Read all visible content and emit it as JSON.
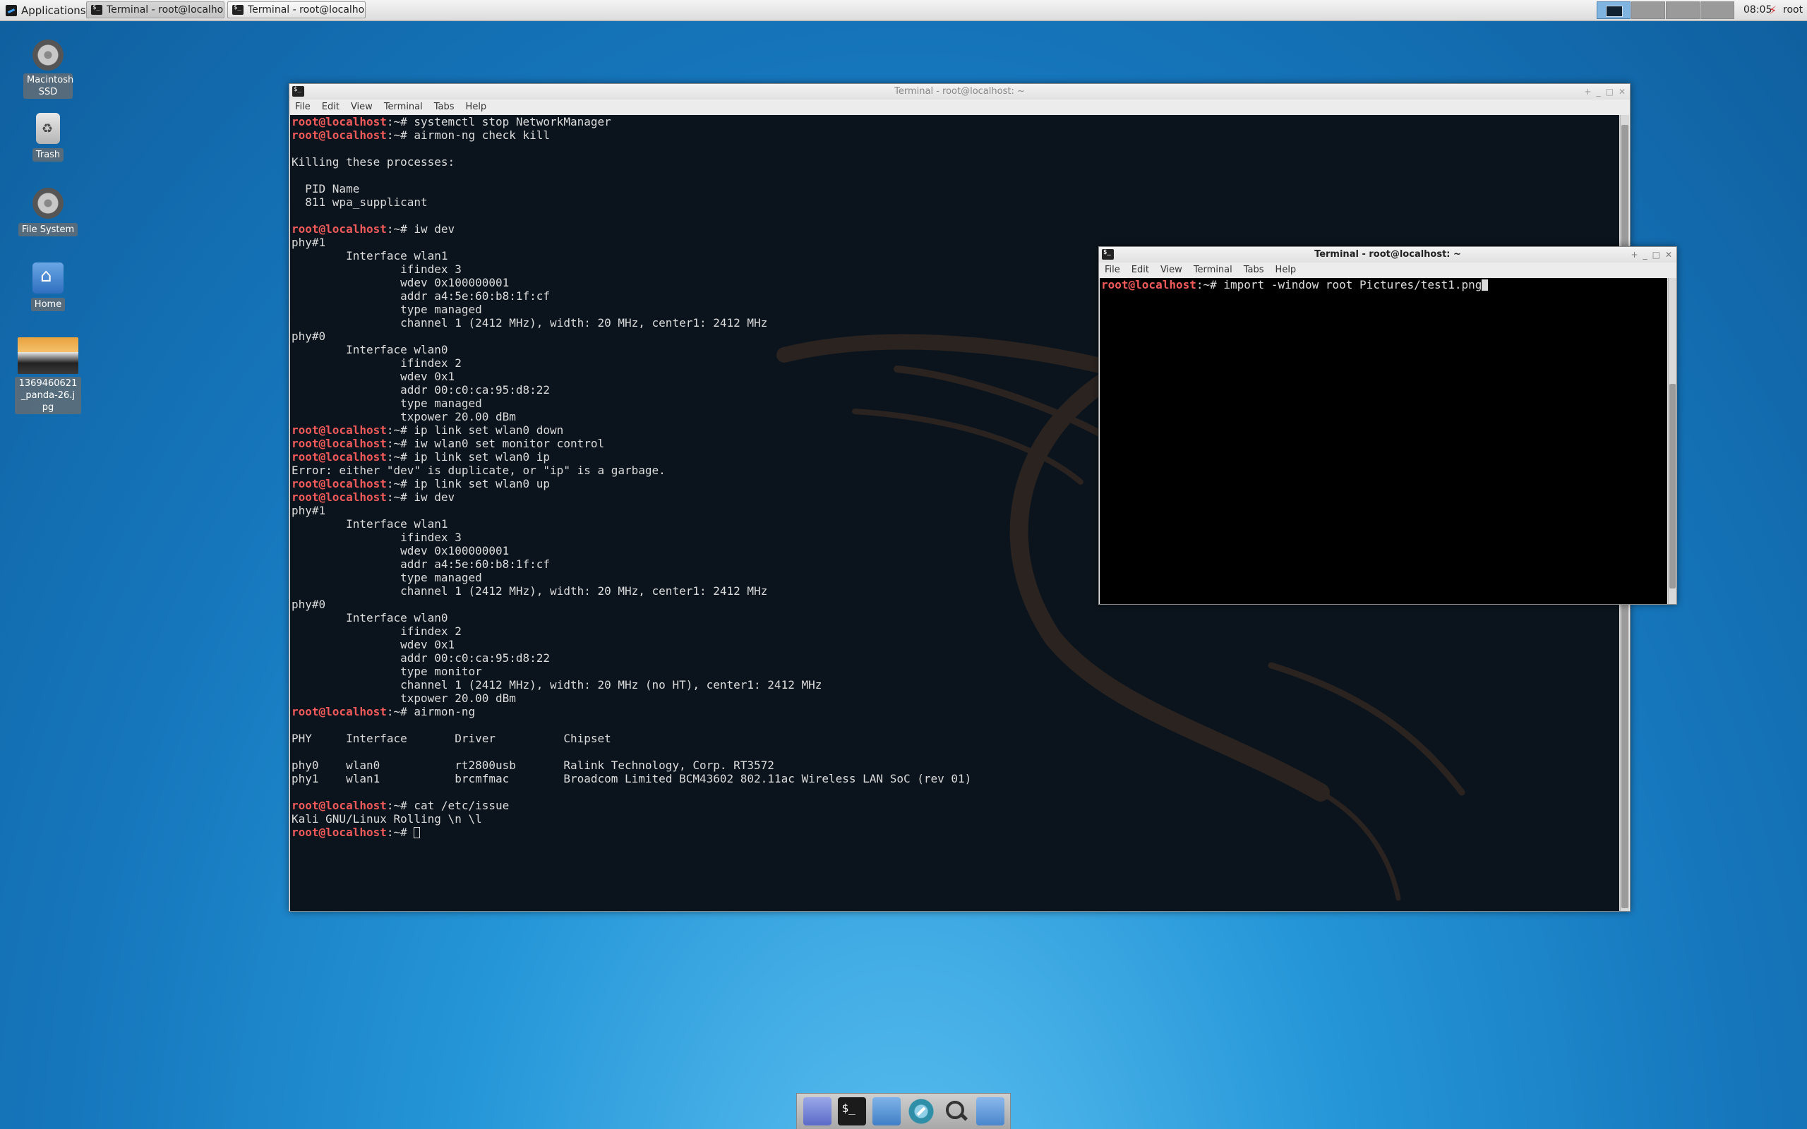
{
  "panel": {
    "applications_label": "Applications",
    "tasks": [
      "Terminal - root@localho...",
      "Terminal - root@localho..."
    ],
    "clock": "08:05",
    "user": "root"
  },
  "desktop": {
    "icons": [
      {
        "name": "macintosh-ssd",
        "label": "Macintosh SSD"
      },
      {
        "name": "trash",
        "label": "Trash"
      },
      {
        "name": "file-system",
        "label": "File System"
      },
      {
        "name": "home",
        "label": "Home"
      },
      {
        "name": "panda-image",
        "label": "1369460621_panda-26.jpg"
      }
    ]
  },
  "main_window": {
    "title": "Terminal - root@localhost: ~",
    "menu": [
      "File",
      "Edit",
      "View",
      "Terminal",
      "Tabs",
      "Help"
    ],
    "lines": [
      {
        "p": "root@localhost",
        "s": ":~# ",
        "t": "systemctl stop NetworkManager"
      },
      {
        "p": "root@localhost",
        "s": ":~# ",
        "t": "airmon-ng check kill"
      },
      {
        "t": ""
      },
      {
        "t": "Killing these processes:"
      },
      {
        "t": ""
      },
      {
        "t": "  PID Name"
      },
      {
        "t": "  811 wpa_supplicant"
      },
      {
        "t": ""
      },
      {
        "p": "root@localhost",
        "s": ":~# ",
        "t": "iw dev"
      },
      {
        "t": "phy#1"
      },
      {
        "t": "        Interface wlan1"
      },
      {
        "t": "                ifindex 3"
      },
      {
        "t": "                wdev 0x100000001"
      },
      {
        "t": "                addr a4:5e:60:b8:1f:cf"
      },
      {
        "t": "                type managed"
      },
      {
        "t": "                channel 1 (2412 MHz), width: 20 MHz, center1: 2412 MHz"
      },
      {
        "t": "phy#0"
      },
      {
        "t": "        Interface wlan0"
      },
      {
        "t": "                ifindex 2"
      },
      {
        "t": "                wdev 0x1"
      },
      {
        "t": "                addr 00:c0:ca:95:d8:22"
      },
      {
        "t": "                type managed"
      },
      {
        "t": "                txpower 20.00 dBm"
      },
      {
        "p": "root@localhost",
        "s": ":~# ",
        "t": "ip link set wlan0 down"
      },
      {
        "p": "root@localhost",
        "s": ":~# ",
        "t": "iw wlan0 set monitor control"
      },
      {
        "p": "root@localhost",
        "s": ":~# ",
        "t": "ip link set wlan0 ip"
      },
      {
        "t": "Error: either \"dev\" is duplicate, or \"ip\" is a garbage."
      },
      {
        "p": "root@localhost",
        "s": ":~# ",
        "t": "ip link set wlan0 up"
      },
      {
        "p": "root@localhost",
        "s": ":~# ",
        "t": "iw dev"
      },
      {
        "t": "phy#1"
      },
      {
        "t": "        Interface wlan1"
      },
      {
        "t": "                ifindex 3"
      },
      {
        "t": "                wdev 0x100000001"
      },
      {
        "t": "                addr a4:5e:60:b8:1f:cf"
      },
      {
        "t": "                type managed"
      },
      {
        "t": "                channel 1 (2412 MHz), width: 20 MHz, center1: 2412 MHz"
      },
      {
        "t": "phy#0"
      },
      {
        "t": "        Interface wlan0"
      },
      {
        "t": "                ifindex 2"
      },
      {
        "t": "                wdev 0x1"
      },
      {
        "t": "                addr 00:c0:ca:95:d8:22"
      },
      {
        "t": "                type monitor"
      },
      {
        "t": "                channel 1 (2412 MHz), width: 20 MHz (no HT), center1: 2412 MHz"
      },
      {
        "t": "                txpower 20.00 dBm"
      },
      {
        "p": "root@localhost",
        "s": ":~# ",
        "t": "airmon-ng"
      },
      {
        "t": ""
      },
      {
        "t": "PHY     Interface       Driver          Chipset"
      },
      {
        "t": ""
      },
      {
        "t": "phy0    wlan0           rt2800usb       Ralink Technology, Corp. RT3572"
      },
      {
        "t": "phy1    wlan1           brcmfmac        Broadcom Limited BCM43602 802.11ac Wireless LAN SoC (rev 01)"
      },
      {
        "t": ""
      },
      {
        "p": "root@localhost",
        "s": ":~# ",
        "t": "cat /etc/issue"
      },
      {
        "t": "Kali GNU/Linux Rolling \\n \\l"
      },
      {
        "p": "root@localhost",
        "s": ":~# ",
        "t": "",
        "cursor": true
      }
    ]
  },
  "second_window": {
    "title": "Terminal - root@localhost: ~",
    "menu": [
      "File",
      "Edit",
      "View",
      "Terminal",
      "Tabs",
      "Help"
    ],
    "lines": [
      {
        "p": "root@localhost",
        "s": ":~# ",
        "t": "import -window root Pictures/test1.png",
        "cursor": true,
        "solid": true
      }
    ]
  },
  "dock": {
    "items": [
      "show-desktop",
      "terminal",
      "file-manager",
      "web-browser",
      "app-finder",
      "folder"
    ]
  },
  "colors": {
    "prompt": "#f05a5a",
    "terminal_bg": "#0b141c",
    "terminal_fg": "#dcdcdc"
  }
}
